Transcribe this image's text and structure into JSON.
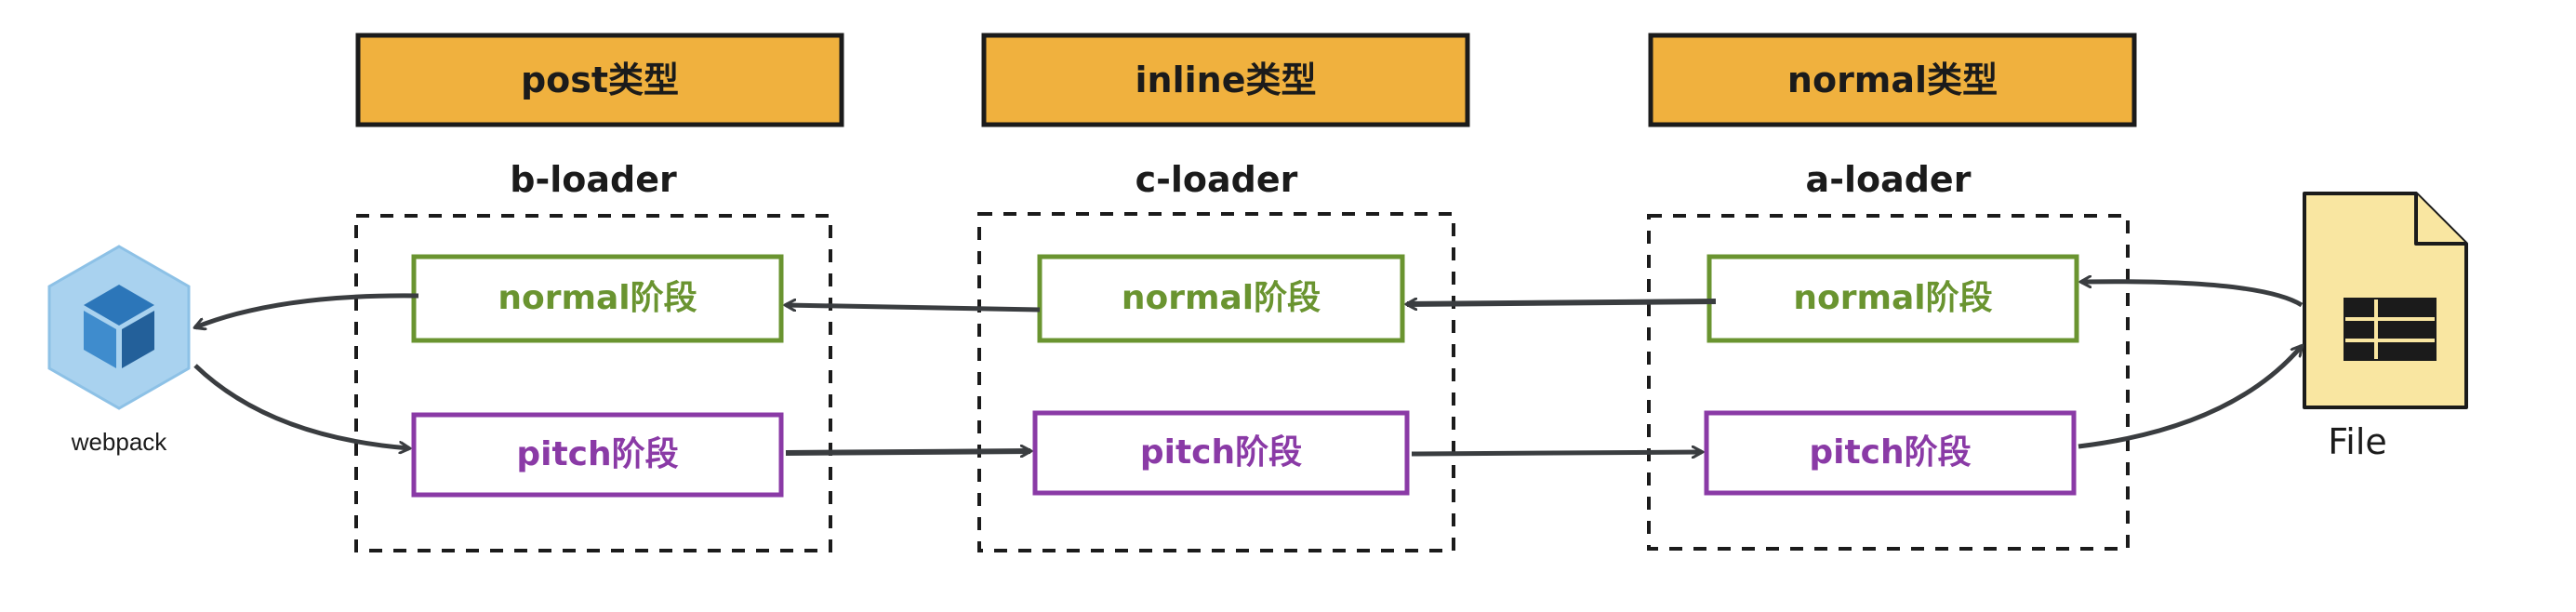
{
  "types": [
    "post类型",
    "inline类型",
    "normal类型"
  ],
  "loaders": [
    "b-loader",
    "c-loader",
    "a-loader"
  ],
  "normal_stage_label": "normal阶段",
  "pitch_stage_label": "pitch阶段",
  "webpack_label": "webpack",
  "file_label": "File",
  "colors": {
    "type_fill": "#f0b13e",
    "normal": "#6a9430",
    "pitch": "#8a3aa6",
    "file_fill": "#f9e6a1",
    "webpack_light": "#a9d2ef",
    "webpack_dark": "#2c76b9",
    "arrow": "#3a3d40"
  }
}
